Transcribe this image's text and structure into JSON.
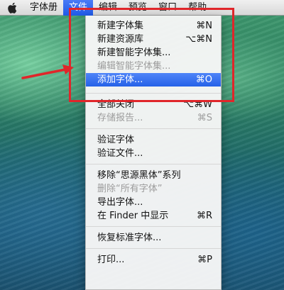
{
  "menubar": {
    "apple_icon": "apple-logo-icon",
    "menus": [
      "字体册",
      "文件",
      "编辑",
      "预览",
      "窗口",
      "帮助"
    ],
    "active_menu": "文件"
  },
  "file_menu": {
    "items": [
      {
        "label": "新建字体集",
        "shortcut": "⌘N",
        "enabled": true
      },
      {
        "label": "新建资源库",
        "shortcut": "⌥⌘N",
        "enabled": true
      },
      {
        "label": "新建智能字体集...",
        "shortcut": "",
        "enabled": true
      },
      {
        "label": "编辑智能字体集...",
        "shortcut": "",
        "enabled": false
      },
      {
        "label": "添加字体...",
        "shortcut": "⌘O",
        "enabled": true,
        "highlighted": true
      },
      {
        "label": "全部关闭",
        "shortcut": "⌥⌘W",
        "enabled": true
      },
      {
        "label": "存储报告...",
        "shortcut": "⌘S",
        "enabled": false
      },
      {
        "label": "验证字体",
        "shortcut": "",
        "enabled": true
      },
      {
        "label": "验证文件...",
        "shortcut": "",
        "enabled": true
      },
      {
        "label": "移除“思源黑体”系列",
        "shortcut": "",
        "enabled": true
      },
      {
        "label": "删除“所有字体”",
        "shortcut": "",
        "enabled": false
      },
      {
        "label": "导出字体...",
        "shortcut": "",
        "enabled": true
      },
      {
        "label": "在 Finder 中显示",
        "shortcut": "⌘R",
        "enabled": true
      },
      {
        "label": "恢复标准字体...",
        "shortcut": "",
        "enabled": true
      },
      {
        "label": "打印...",
        "shortcut": "⌘P",
        "enabled": true
      }
    ]
  },
  "annotation": {
    "color": "#e0262a"
  }
}
